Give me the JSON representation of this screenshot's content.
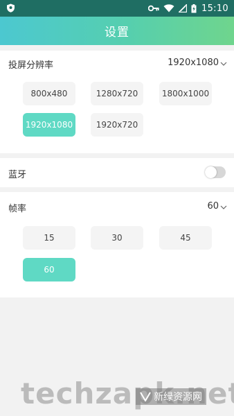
{
  "status_bar": {
    "time": "15:10",
    "icons": [
      "shield-icon",
      "key-icon",
      "wifi-icon",
      "signal-icon",
      "battery-charging-icon"
    ]
  },
  "app_bar": {
    "title": "设置",
    "gradient_colors": [
      "#4cc8d0",
      "#6fd58d"
    ]
  },
  "resolution": {
    "label": "投屏分辨率",
    "selected": "1920x1080",
    "options": [
      "800x480",
      "1280x720",
      "1800x1000",
      "1920x1080",
      "1920x720"
    ]
  },
  "bluetooth": {
    "label": "蓝牙",
    "enabled": false
  },
  "frame_rate": {
    "label": "帧率",
    "selected": "60",
    "options": [
      "15",
      "30",
      "45",
      "60"
    ]
  },
  "watermark": {
    "text": "techzapk.net",
    "badge": "新绿资源网"
  },
  "colors": {
    "accent": "#5fd9c4",
    "status_bar": "#1f6e63"
  }
}
